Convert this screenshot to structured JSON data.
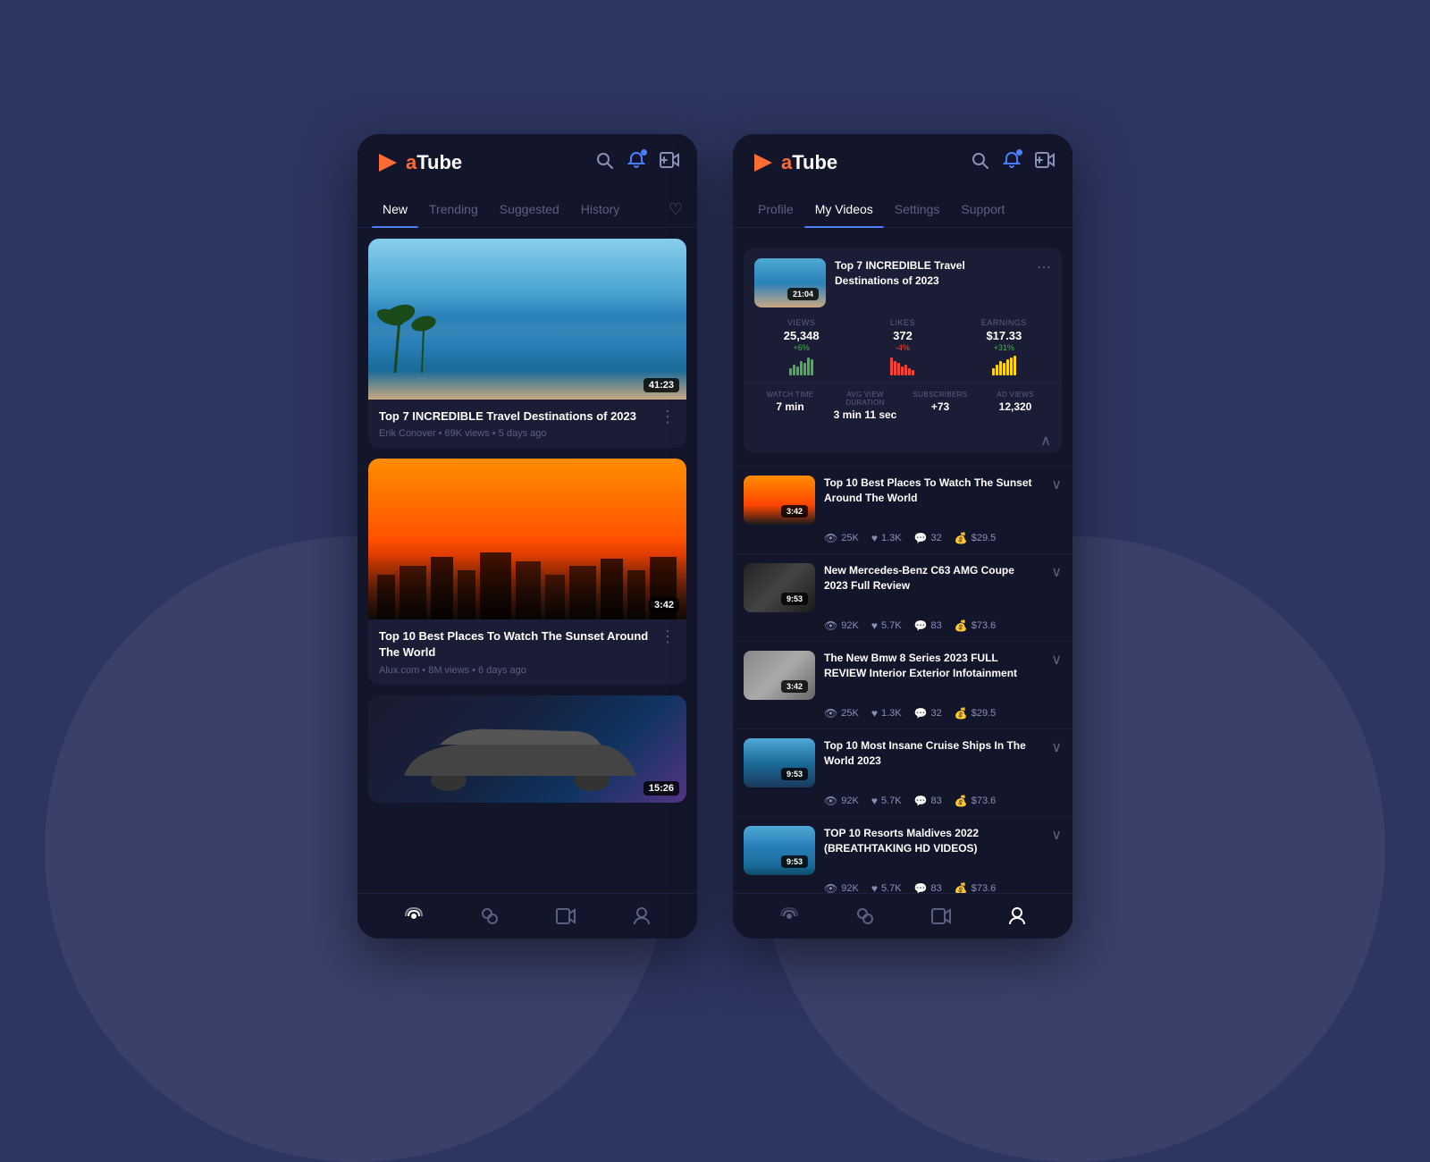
{
  "app": {
    "name_prefix": "a",
    "name_suffix": "Tube"
  },
  "left_screen": {
    "header": {
      "logo": "aTube",
      "icons": [
        "search",
        "notification",
        "add-video"
      ]
    },
    "nav_tabs": [
      {
        "label": "New",
        "active": true
      },
      {
        "label": "Trending",
        "active": false
      },
      {
        "label": "Suggested",
        "active": false
      },
      {
        "label": "History",
        "active": false
      }
    ],
    "videos": [
      {
        "title": "Top 7 INCREDIBLE Travel Destinations of 2023",
        "channel": "Erik Conover",
        "views": "69K views",
        "time": "5 days ago",
        "duration": "41:23",
        "thumb_type": "beach"
      },
      {
        "title": "Top 10 Best Places To Watch The Sunset Around The World",
        "channel": "Alux.com",
        "views": "8M views",
        "time": "6 days ago",
        "duration": "3:42",
        "thumb_type": "city"
      },
      {
        "title": "",
        "channel": "",
        "views": "",
        "time": "",
        "duration": "15:26",
        "thumb_type": "car"
      }
    ],
    "bottom_nav": [
      "broadcast",
      "explore",
      "video",
      "profile"
    ]
  },
  "right_screen": {
    "header": {
      "logo": "aTube",
      "icons": [
        "search",
        "notification",
        "add-video"
      ]
    },
    "nav_tabs": [
      {
        "label": "Profile",
        "active": false
      },
      {
        "label": "My Videos",
        "active": true
      },
      {
        "label": "Settings",
        "active": false
      },
      {
        "label": "Support",
        "active": false
      }
    ],
    "expanded_video": {
      "title": "Top 7 INCREDIBLE Travel Destinations of 2023",
      "duration": "21:04",
      "thumb_type": "beach",
      "stats": {
        "views": {
          "label": "VIEWS",
          "value": "25,348",
          "change": "+6%",
          "positive": true
        },
        "likes": {
          "label": "LIKES",
          "value": "372",
          "change": "-4%",
          "positive": false
        },
        "earnings": {
          "label": "EARNINGS",
          "value": "$17.33",
          "change": "+31%",
          "positive": true
        }
      },
      "bottom_stats": {
        "watch_time": {
          "label": "WATCH TIME",
          "value": "7 min"
        },
        "avg_view": {
          "label": "AVG VIEW DURATION",
          "value": "3 min 11 sec"
        },
        "subscribers": {
          "label": "SUBSCRIBERS",
          "value": "+73"
        },
        "ad_views": {
          "label": "AD VIEWS",
          "value": "12,320"
        }
      }
    },
    "my_videos": [
      {
        "title": "Top 10 Best Places To Watch The Sunset Around The World",
        "duration": "3:42",
        "thumb_type": "city",
        "views": "25K",
        "likes": "1.3K",
        "comments": "32",
        "earnings": "$29.5"
      },
      {
        "title": "New Mercedes-Benz C63 AMG Coupe 2023 Full Review",
        "duration": "9:53",
        "thumb_type": "car_black",
        "views": "92K",
        "likes": "5.7K",
        "comments": "83",
        "earnings": "$73.6"
      },
      {
        "title": "The New Bmw 8 Series 2023 FULL REVIEW Interior Exterior Infotainment",
        "duration": "3:42",
        "thumb_type": "car_silver",
        "views": "25K",
        "likes": "1.3K",
        "comments": "32",
        "earnings": "$29.5"
      },
      {
        "title": "Top 10 Most Insane Cruise Ships In The World 2023",
        "duration": "9:53",
        "thumb_type": "cruise",
        "views": "92K",
        "likes": "5.7K",
        "comments": "83",
        "earnings": "$73.6"
      },
      {
        "title": "TOP 10 Resorts Maldives 2022 (BREATHTAKING HD VIDEOS)",
        "duration": "9:53",
        "thumb_type": "resort",
        "views": "92K",
        "likes": "5.7K",
        "comments": "83",
        "earnings": "$73.6"
      }
    ],
    "bottom_nav": [
      "broadcast",
      "explore",
      "video",
      "profile"
    ]
  }
}
